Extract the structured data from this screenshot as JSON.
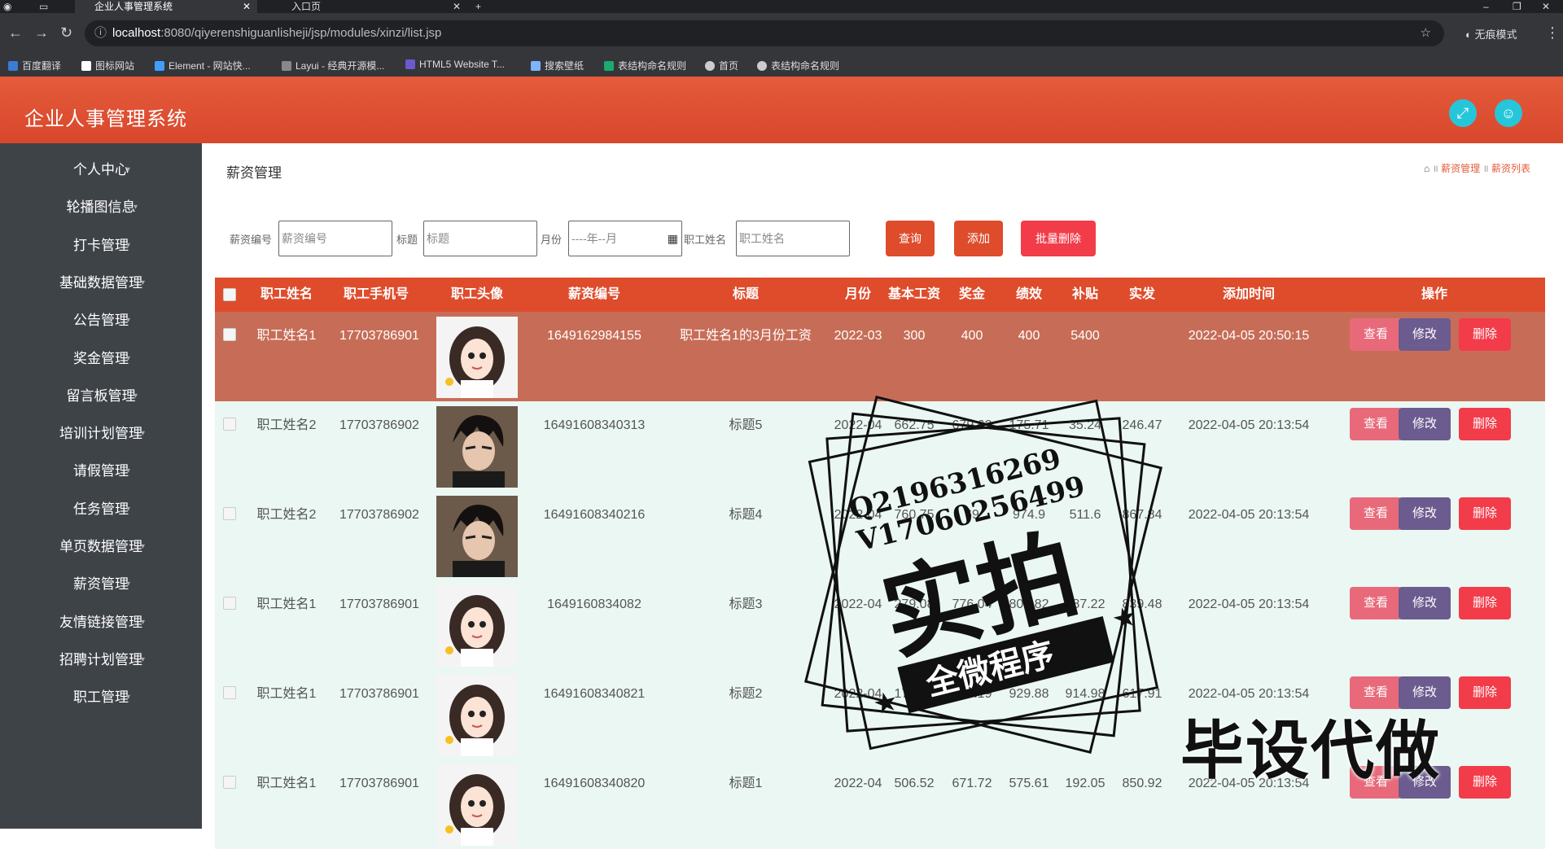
{
  "browser": {
    "tabs": [
      {
        "title": "企业人事管理系统"
      },
      {
        "title": "入口页"
      }
    ],
    "url_host": "localhost",
    "url_path": ":8080/qiyerenshiguanlisheji/jsp/modules/xinzi/list.jsp",
    "incognito": "无痕模式",
    "bookmarks": [
      "百度翻译",
      "图标网站",
      "Element - 网站快...",
      "Layui - 经典开源模...",
      "HTML5 Website T...",
      "搜索壁纸",
      "表结构命名规则",
      "首页",
      "表结构命名规则"
    ]
  },
  "app": {
    "title": "企业人事管理系统"
  },
  "sidebar": {
    "items": [
      "个人中心",
      "轮播图信息",
      "打卡管理",
      "基础数据管理",
      "公告管理",
      "奖金管理",
      "留言板管理",
      "培训计划管理",
      "请假管理",
      "任务管理",
      "单页数据管理",
      "薪资管理",
      "友情链接管理",
      "招聘计划管理",
      "职工管理"
    ]
  },
  "page": {
    "title": "薪资管理",
    "breadcrumb": [
      "薪资管理",
      "薪资列表"
    ]
  },
  "search": {
    "salary_no_label": "薪资编号",
    "salary_no_placeholder": "薪资编号",
    "title_label": "标题",
    "title_placeholder": "标题",
    "month_label": "月份",
    "month_placeholder": "----年--月",
    "name_label": "职工姓名",
    "name_placeholder": "职工姓名",
    "query": "查询",
    "add": "添加",
    "batch_delete": "批量删除"
  },
  "table": {
    "headers": [
      "职工姓名",
      "职工手机号",
      "职工头像",
      "薪资编号",
      "标题",
      "月份",
      "基本工资",
      "奖金",
      "绩效",
      "补贴",
      "实发",
      "添加时间",
      "操作"
    ],
    "rows": [
      {
        "name": "职工姓名1",
        "phone": "17703786901",
        "no": "1649162984155",
        "title": "职工姓名1的3月份工资",
        "month": "2022-03",
        "base": "300",
        "bonus": "400",
        "perf": "400",
        "subsidy": "5400",
        "actual": "",
        "time": "2022-04-05 20:50:15",
        "avatar": "girl"
      },
      {
        "name": "职工姓名2",
        "phone": "17703786902",
        "no": "16491608340313",
        "title": "标题5",
        "month": "2022-04",
        "base": "662.75",
        "bonus": "679.62",
        "perf": "175.71",
        "subsidy": "35.24",
        "actual": "246.47",
        "time": "2022-04-05 20:13:54",
        "avatar": "boy"
      },
      {
        "name": "职工姓名2",
        "phone": "17703786902",
        "no": "16491608340216",
        "title": "标题4",
        "month": "2022-04",
        "base": "760.75",
        "bonus": "69",
        "perf": "974.9",
        "subsidy": "511.6",
        "actual": "867.84",
        "time": "2022-04-05 20:13:54",
        "avatar": "boy"
      },
      {
        "name": "职工姓名1",
        "phone": "17703786901",
        "no": "1649160834082",
        "title": "标题3",
        "month": "2022-04",
        "base": "279.08",
        "bonus": "776.04",
        "perf": "807.82",
        "subsidy": "487.22",
        "actual": "839.48",
        "time": "2022-04-05 20:13:54",
        "avatar": "girl"
      },
      {
        "name": "职工姓名1",
        "phone": "17703786901",
        "no": "16491608340821",
        "title": "标题2",
        "month": "2022-04",
        "base": "173.94",
        "bonus": "413.19",
        "perf": "929.88",
        "subsidy": "914.98",
        "actual": "617.91",
        "time": "2022-04-05 20:13:54",
        "avatar": "girl"
      },
      {
        "name": "职工姓名1",
        "phone": "17703786901",
        "no": "16491608340820",
        "title": "标题1",
        "month": "2022-04",
        "base": "506.52",
        "bonus": "671.72",
        "perf": "575.61",
        "subsidy": "192.05",
        "actual": "850.92",
        "time": "2022-04-05 20:13:54",
        "avatar": "girl"
      }
    ],
    "actions": {
      "view": "查看",
      "edit": "修改",
      "delete": "删除"
    }
  },
  "watermark": {
    "line1": "Q2196316269",
    "line2": "V17060256499",
    "big": "实拍",
    "ribbon": "全微程序",
    "corner": "毕设代做"
  },
  "colors": {
    "accent": "#de4c2c",
    "sidebar": "#3e4348",
    "view_btn": "#e86a7a",
    "edit_btn": "#6b5b8e",
    "delete_btn": "#f23c4a",
    "header_icon": "#26c6da"
  }
}
